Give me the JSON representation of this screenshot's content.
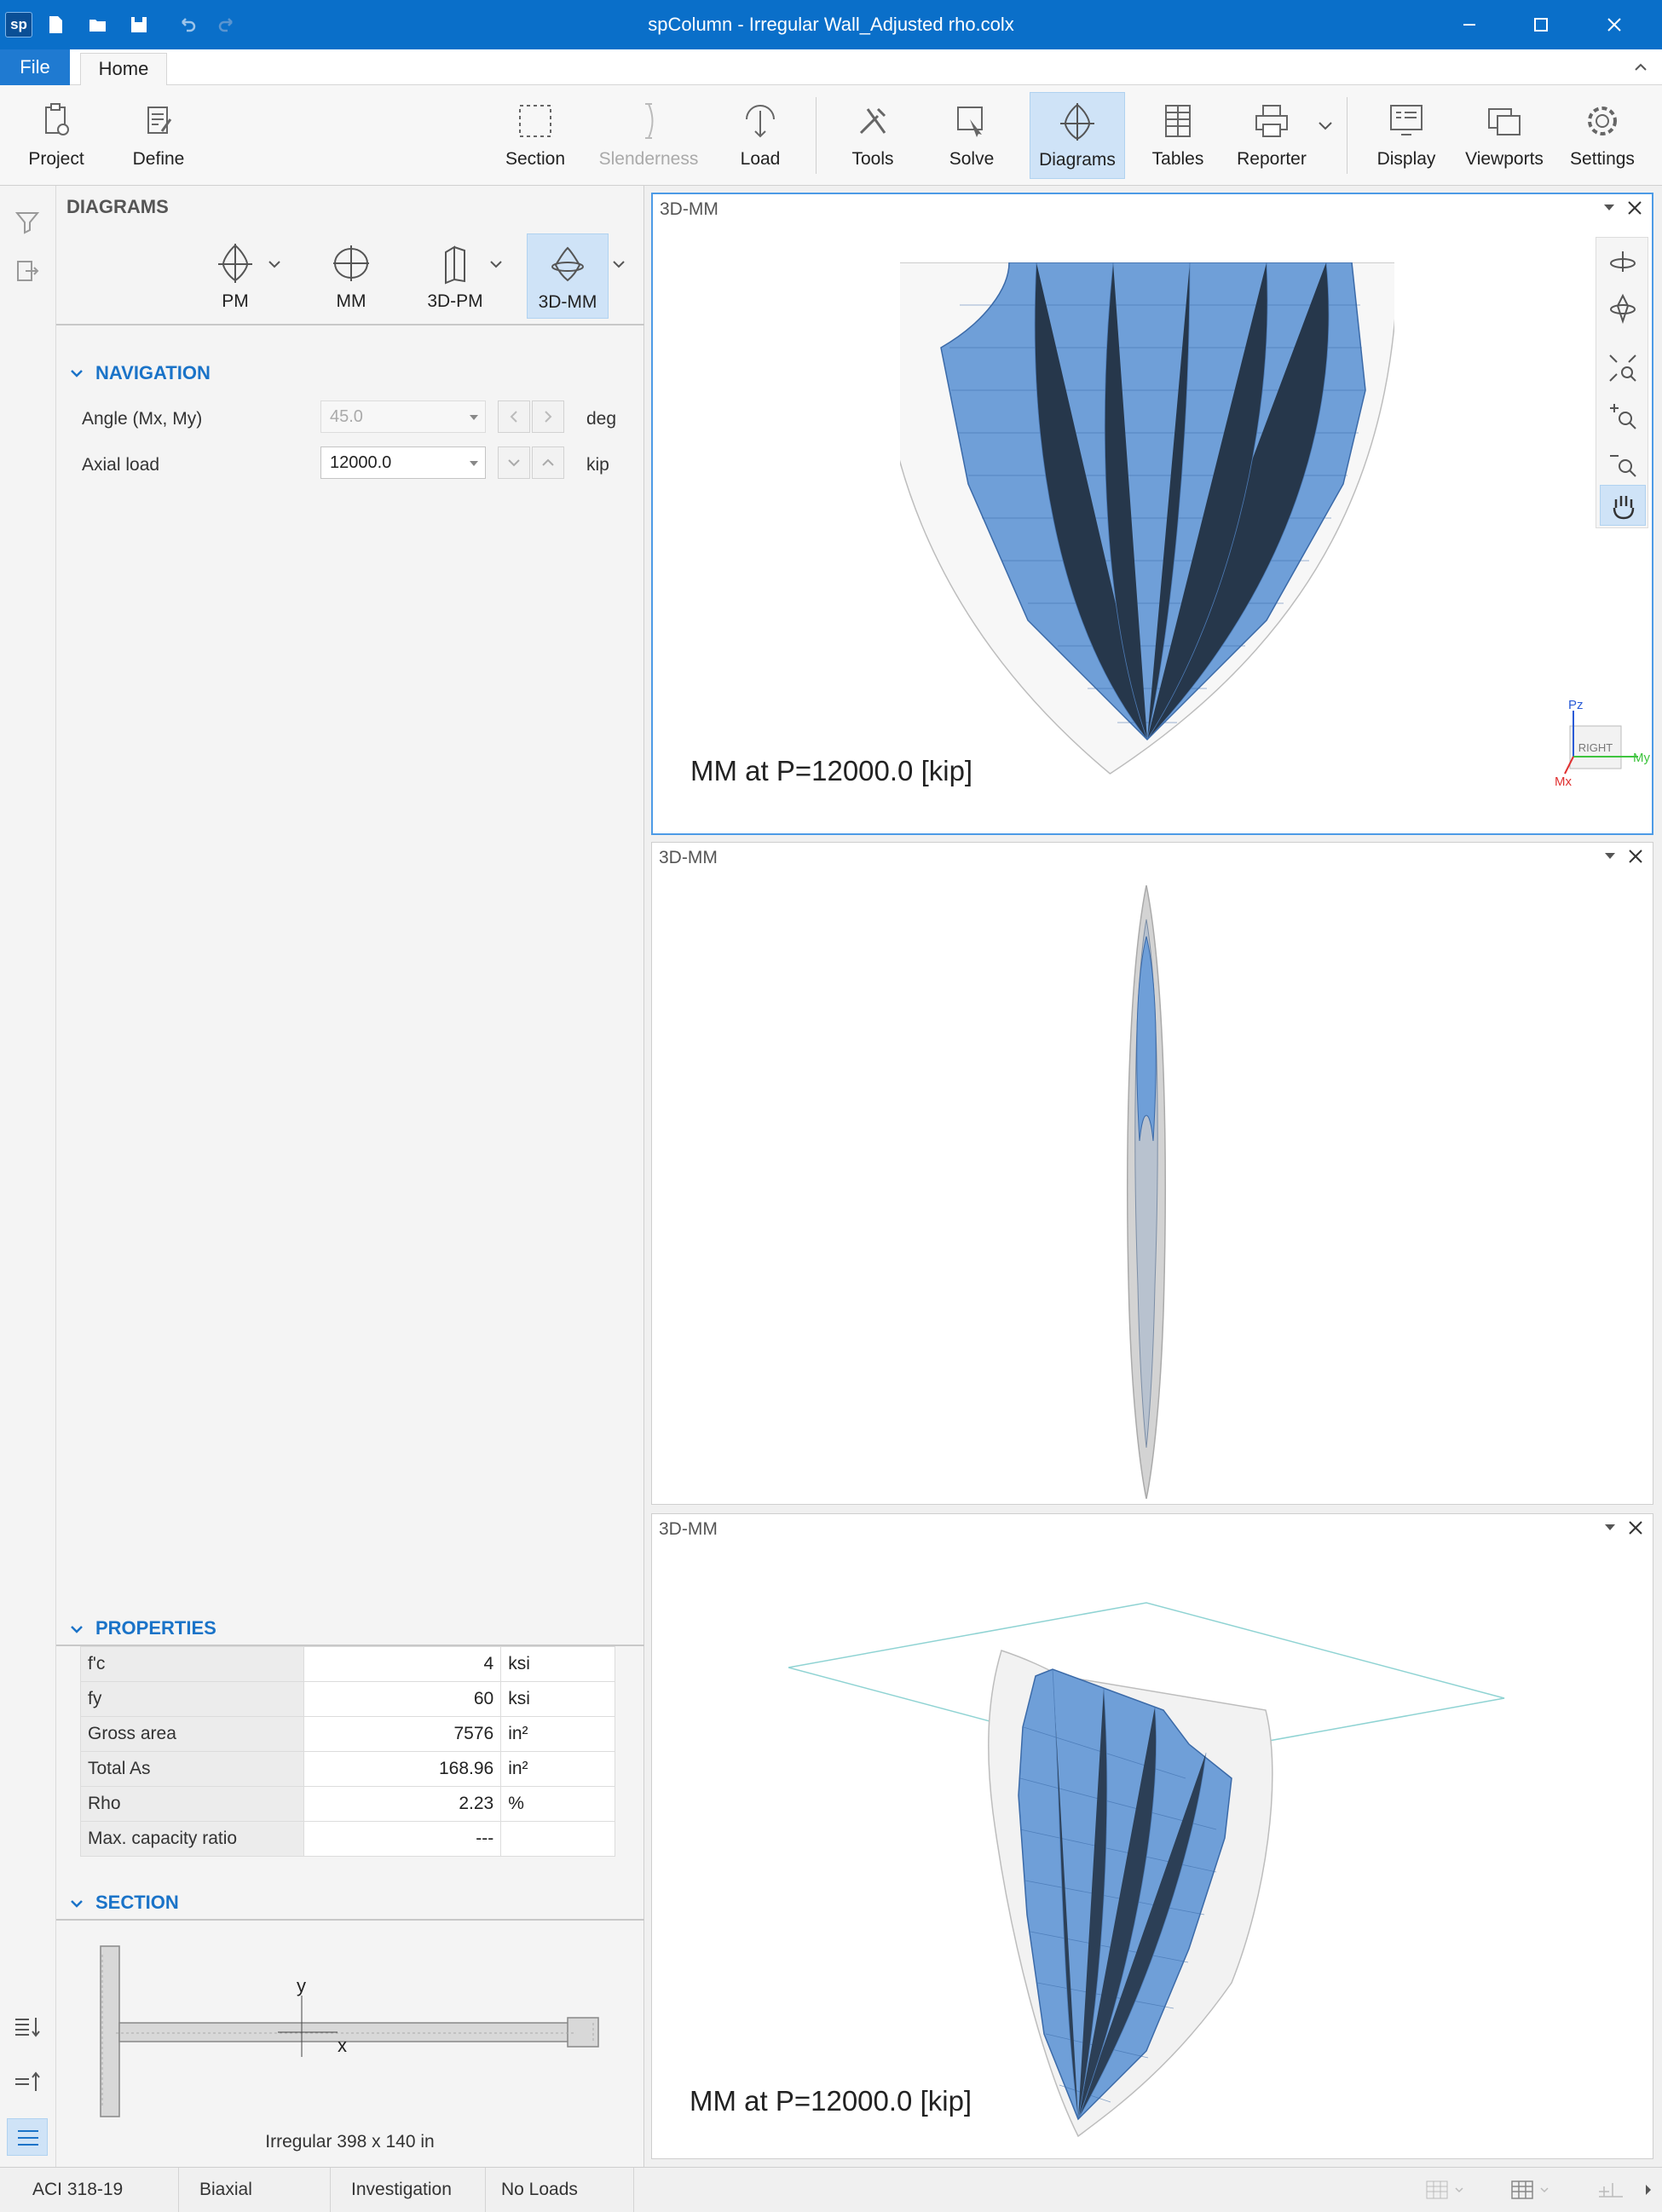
{
  "app": {
    "logo": "sp",
    "title": "spColumn - Irregular Wall_Adjusted rho.colx"
  },
  "ribbon_tabs": {
    "file": "File",
    "home": "Home"
  },
  "ribbon": {
    "project": "Project",
    "define": "Define",
    "section": "Section",
    "slenderness": "Slenderness",
    "load": "Load",
    "tools": "Tools",
    "solve": "Solve",
    "diagrams": "Diagrams",
    "tables": "Tables",
    "reporter": "Reporter",
    "display": "Display",
    "viewports": "Viewports",
    "settings": "Settings"
  },
  "diagrams_panel": {
    "title": "DIAGRAMS",
    "buttons": {
      "pm": "PM",
      "mm": "MM",
      "pm3d": "3D-PM",
      "mm3d": "3D-MM"
    },
    "active": "3D-MM"
  },
  "navigation": {
    "heading": "NAVIGATION",
    "angle_label": "Angle (Mx, My)",
    "angle_value": "45.0",
    "angle_unit": "deg",
    "axial_label": "Axial load",
    "axial_value": "12000.0",
    "axial_unit": "kip"
  },
  "properties": {
    "heading": "PROPERTIES",
    "rows": [
      {
        "name": "f'c",
        "value": "4",
        "unit": "ksi"
      },
      {
        "name": "fy",
        "value": "60",
        "unit": "ksi"
      },
      {
        "name": "Gross area",
        "value": "7576",
        "unit": "in²"
      },
      {
        "name": "Total As",
        "value": "168.96",
        "unit": "in²"
      },
      {
        "name": "Rho",
        "value": "2.23",
        "unit": "%"
      },
      {
        "name": "Max. capacity ratio",
        "value": "---",
        "unit": ""
      }
    ]
  },
  "section": {
    "heading": "SECTION",
    "axis_y": "y",
    "axis_x": "x",
    "caption": "Irregular 398 x 140 in"
  },
  "viewports": [
    {
      "title": "3D-MM",
      "caption": "MM at P=12000.0 [kip]"
    },
    {
      "title": "3D-MM",
      "caption": ""
    },
    {
      "title": "3D-MM",
      "caption": "MM at P=12000.0 [kip]"
    }
  ],
  "view_cube": {
    "face": "RIGHT",
    "pz": "Pz",
    "my": "My",
    "mx": "Mx"
  },
  "colors": {
    "accent": "#0a6fc9",
    "surface": "#6f9fd8",
    "surface_edge": "#3b6aa8",
    "active_bg": "#cfe3f7",
    "heading": "#1a73c8"
  },
  "statusbar": {
    "code": "ACI 318-19",
    "mode": "Biaxial",
    "run": "Investigation",
    "loads": "No Loads"
  }
}
